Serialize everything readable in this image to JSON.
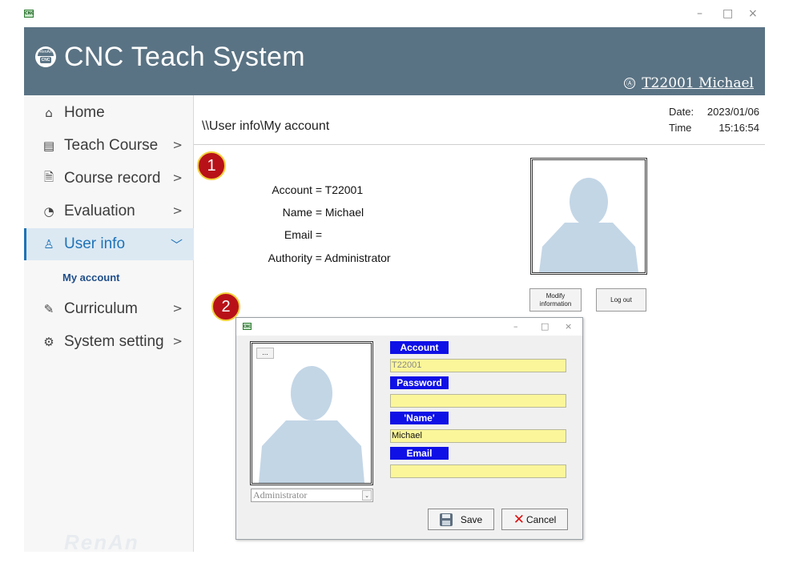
{
  "window": {
    "icon_text": "CNC",
    "controls": {
      "minimize": "–",
      "maximize": "□",
      "close": "×"
    }
  },
  "header": {
    "title": "CNC Teach System",
    "logo_text": {
      "top": "RenAn",
      "badge": "CNC"
    },
    "user_icon": "Ⓐ",
    "user": "T22001 Michael"
  },
  "sidebar": {
    "items": [
      {
        "label": "Home",
        "icon": "⌂",
        "chevron": ""
      },
      {
        "label": "Teach Course",
        "icon": "▤",
        "chevron": ">"
      },
      {
        "label": "Course record",
        "icon": "🗎",
        "chevron": ">"
      },
      {
        "label": "Evaluation",
        "icon": "◔",
        "chevron": ">"
      },
      {
        "label": "User info",
        "icon": "♙",
        "chevron": "﹀"
      },
      {
        "label": "Curriculum",
        "icon": "✎",
        "chevron": ">"
      },
      {
        "label": "System setting",
        "icon": "⚙",
        "chevron": ">"
      }
    ],
    "sub_item": "My account",
    "watermark": "RenAn"
  },
  "content": {
    "breadcrumb": "\\\\User info\\My account",
    "date_label": "Date:",
    "date_value": "2023/01/06",
    "time_label": "Time",
    "time_value": "15:16:54",
    "badges": [
      "1",
      "2"
    ],
    "info": {
      "account_label": "Account =",
      "account_value": "T22001",
      "name_label": "Name =",
      "name_value": "Michael",
      "email_label": "Email =",
      "email_value": "",
      "authority_label": "Authority =",
      "authority_value": "Administrator"
    },
    "buttons": {
      "modify": "Modify information",
      "logout": "Log out"
    }
  },
  "dialog": {
    "icon_text": "CNC",
    "controls": {
      "minimize": "–",
      "maximize": "□",
      "close": "×"
    },
    "dots_label": "...",
    "role_value": "Administrator",
    "role_arrow": "⌄",
    "fields": {
      "account_label": "Account",
      "account_value": "T22001",
      "password_label": "Password",
      "password_value": "",
      "name_label": "'Name'",
      "name_value": "Michael",
      "email_label": "Email",
      "email_value": ""
    },
    "save_label": "Save",
    "cancel_label": "Cancel",
    "cancel_icon": "✕"
  },
  "colors": {
    "header_bg": "#5a7384",
    "active_accent": "#1f73b7",
    "field_label_bg": "#0f10e6",
    "field_input_bg": "#fbf69a",
    "badge_red": "#b81218",
    "silhouette": "#c3d6e6"
  }
}
